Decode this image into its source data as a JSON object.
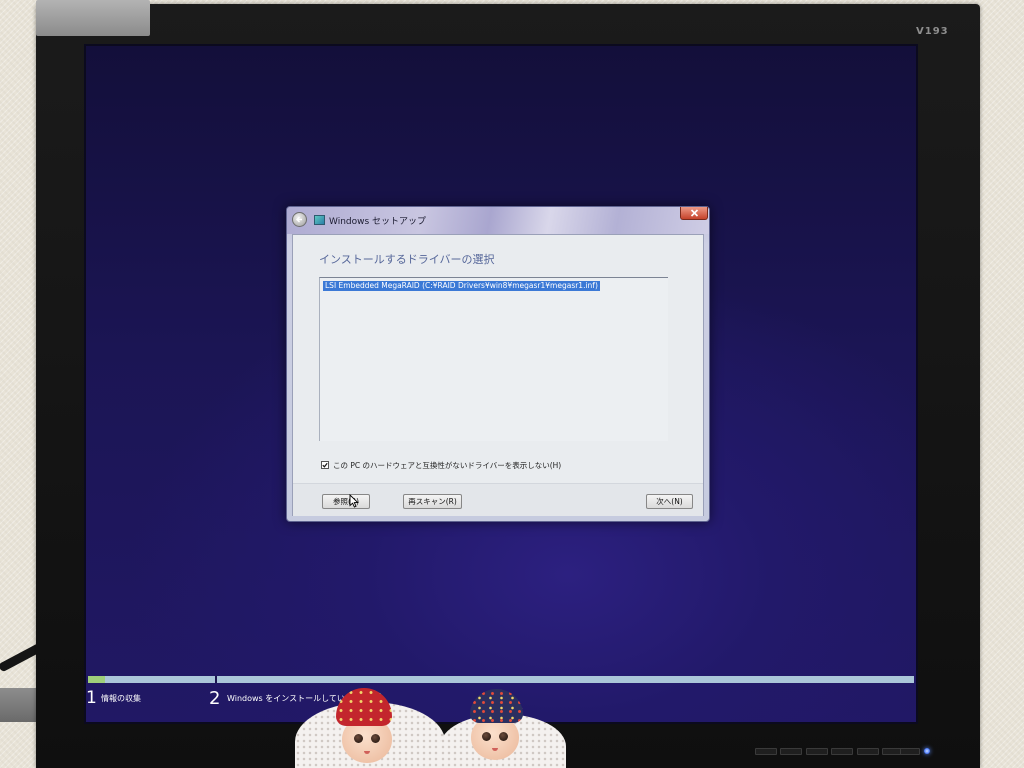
{
  "monitor": {
    "model_label": "V193"
  },
  "dialog": {
    "title": "Windows セットアップ",
    "heading": "インストールするドライバーの選択",
    "driver_list": [
      {
        "label": "LSI Embedded MegaRAID (C:¥RAID Drivers¥win8¥megasr1¥megasr1.inf)",
        "selected": true
      }
    ],
    "hide_incompatible_checkbox": {
      "label": "この PC のハードウェアと互換性がないドライバーを表示しない(H)",
      "checked": true
    },
    "buttons": {
      "browse": "参照(B)",
      "rescan": "再スキャン(R)",
      "next": "次へ(N)"
    }
  },
  "setup_progress": {
    "steps": [
      {
        "number": "1",
        "label": "情報の収集"
      },
      {
        "number": "2",
        "label": "Windows をインストールしています"
      }
    ],
    "current_step_fill": 0.13
  },
  "icons": [
    "back-arrow-icon",
    "setup-icon",
    "close-icon",
    "checkmark-icon",
    "mouse-cursor-icon",
    "power-led-icon"
  ],
  "colors": {
    "screen_background": "#1b1554",
    "selection_highlight": "#3b79d6",
    "progress_track": "#abc6d9",
    "progress_fill": "#9fcf7a",
    "close_button": "#c5432b"
  }
}
